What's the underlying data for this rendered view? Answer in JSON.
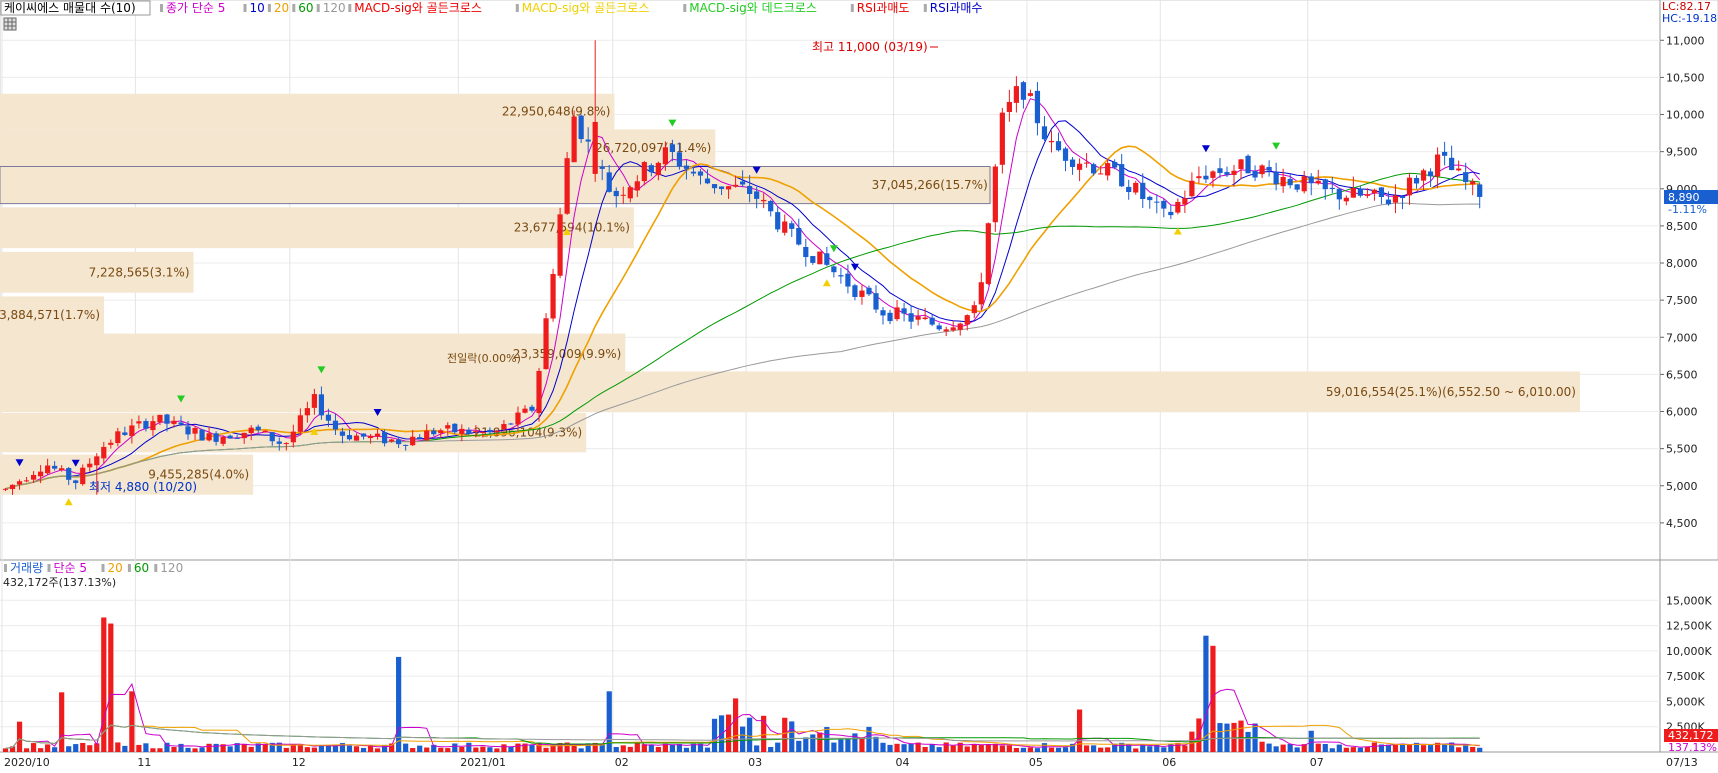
{
  "price_panel": {
    "title": "케이씨에스 매물대 수(10)",
    "legend": [
      {
        "text": "종가 단순 5",
        "color": "#cc00cc"
      },
      {
        "text": "10",
        "color": "#0000cc"
      },
      {
        "text": "20",
        "color": "#f0a000"
      },
      {
        "text": "60",
        "color": "#009900"
      },
      {
        "text": "120",
        "color": "#999999"
      },
      {
        "text": "MACD-sig와 골든크로스",
        "color": "#ee0000"
      },
      {
        "text": "MACD-sig와 골든크로스",
        "color": "#f0d000"
      },
      {
        "text": "MACD-sig와 데드크로스",
        "color": "#22cc22"
      },
      {
        "text": "RSI과매도",
        "color": "#ee0000"
      },
      {
        "text": "RSI과매수",
        "color": "#0000cc"
      }
    ],
    "corner_lc": "LC:82.17",
    "corner_hc": "HC:-19.18",
    "current_price": "8,890",
    "current_change": "-1.11%",
    "high_annotation": "최고 11,000 (03/19)",
    "low_annotation": "최저 4,880 (10/20)",
    "mid_label": "전일락(0.00%)",
    "colors": {
      "up": "#ee1c1c",
      "down": "#1a5fd0",
      "profile": "#f5e6d0",
      "profile_text": "#7a4a10"
    }
  },
  "chart_data": {
    "type": "candlestick",
    "y_ticks": [
      "11,000",
      "10,500",
      "10,000",
      "9,500",
      "9,000",
      "8,500",
      "8,000",
      "7,500",
      "7,000",
      "6,500",
      "6,000",
      "5,500",
      "5,000",
      "4,500"
    ],
    "ylim": [
      4000,
      11300
    ],
    "x_labels": [
      "2020/10",
      "11",
      "12",
      "2021/01",
      "02",
      "03",
      "04",
      "05",
      "06",
      "07",
      "07/13"
    ],
    "volume_profile": [
      {
        "label": "22,950,648(9.8%)",
        "value": 22950648,
        "range": [
          9800,
          10280
        ]
      },
      {
        "label": "26,720,097(11.4%)",
        "value": 26720097,
        "range": [
          9300,
          9800
        ]
      },
      {
        "label": "37,045,266(15.7%)",
        "value": 37045266,
        "range": [
          8800,
          9300
        ]
      },
      {
        "label": "23,677,594(10.1%)",
        "value": 23677594,
        "range": [
          8200,
          8750
        ]
      },
      {
        "label": "7,228,565(3.1%)",
        "value": 7228565,
        "range": [
          7600,
          8150
        ]
      },
      {
        "label": "3,884,571(1.7%)",
        "value": 3884571,
        "range": [
          7050,
          7550
        ]
      },
      {
        "label": "23,359,009(9.9%)",
        "value": 23359009,
        "range": [
          6500,
          7050
        ]
      },
      {
        "label": "59,016,554(25.1%)(6,552.50 ~ 6,010.00)",
        "value": 59016554,
        "range": [
          5990,
          6540
        ]
      },
      {
        "label": "21,896,104(9.3%)",
        "value": 21896104,
        "range": [
          5450,
          5980
        ]
      },
      {
        "label": "9,455,285(4.0%)",
        "value": 9455285,
        "range": [
          4880,
          5420
        ]
      }
    ],
    "high": 11000,
    "low": 4880,
    "last_close": 8890
  },
  "volume_panel": {
    "legend": [
      {
        "text": "거래량",
        "color": "#1a5fd0"
      },
      {
        "text": "단순 5",
        "color": "#cc00cc"
      },
      {
        "text": "20",
        "color": "#f0a000"
      },
      {
        "text": "60",
        "color": "#009900"
      },
      {
        "text": "120",
        "color": "#999999"
      }
    ],
    "last_volume": "432,172주(137.13%)",
    "y_ticks": [
      "15,000K",
      "12,500K",
      "10,000K",
      "7,500K",
      "5,000K",
      "2,500K"
    ],
    "ylim": [
      0,
      17500
    ],
    "current_badge": "432,172",
    "current_pct": "137.13%"
  }
}
